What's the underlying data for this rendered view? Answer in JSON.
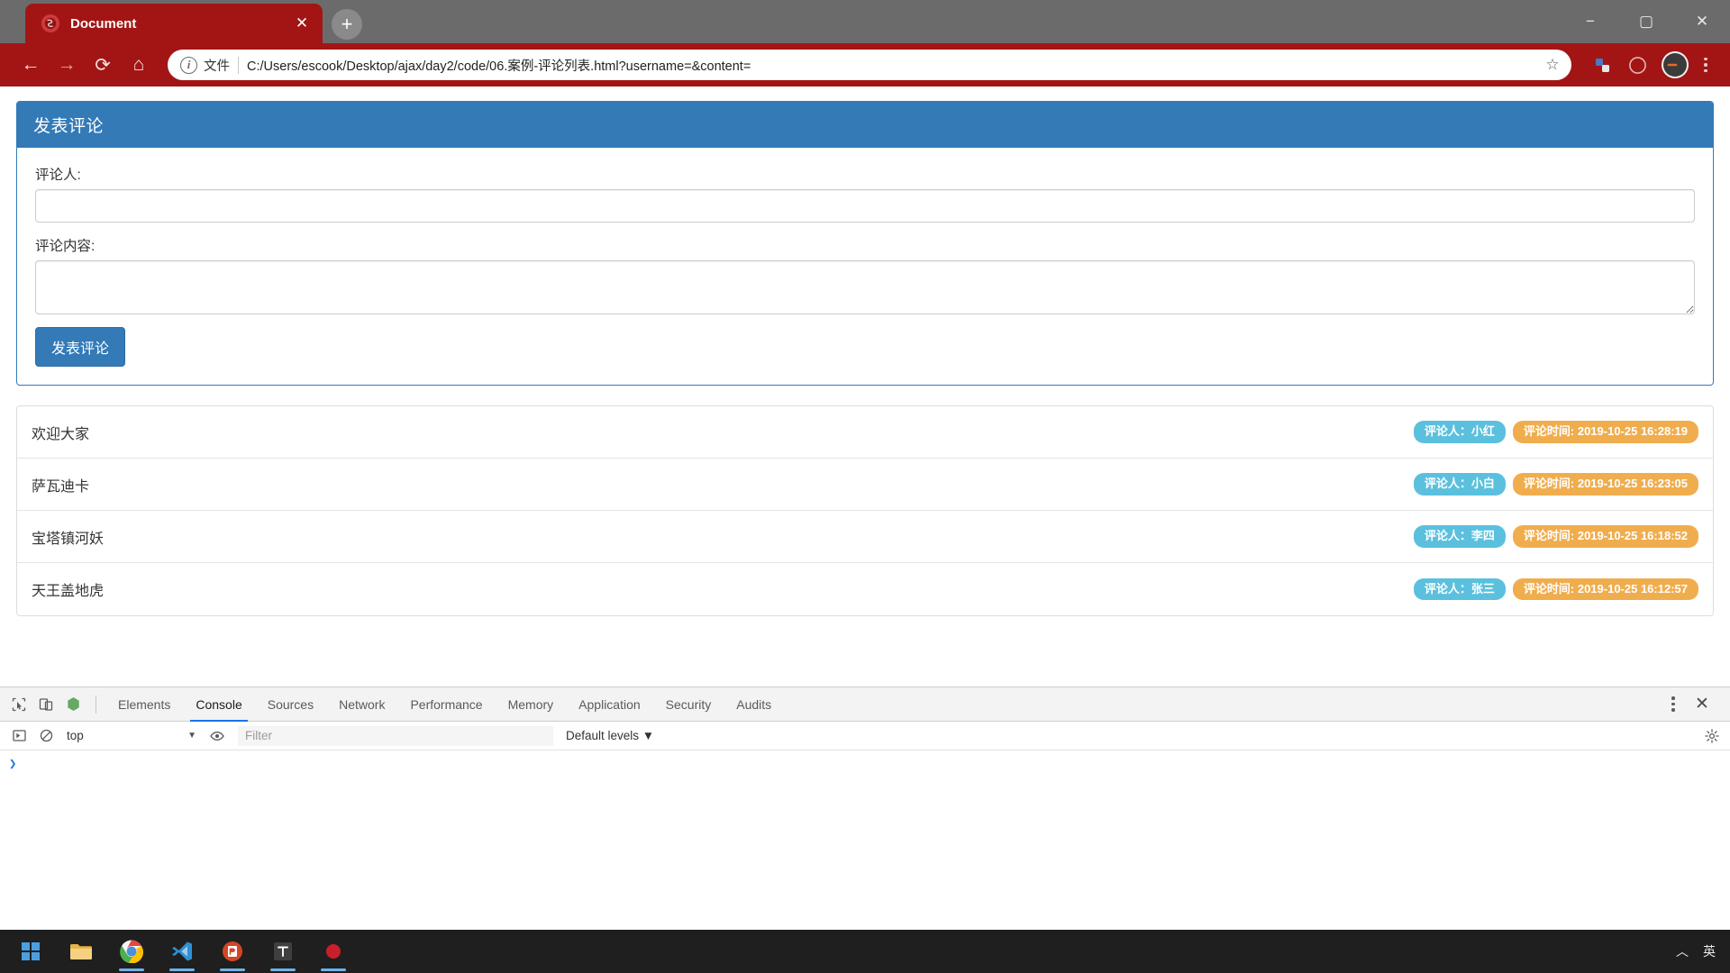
{
  "browser": {
    "tab": {
      "title": "Document",
      "favicon_name": "site-favicon",
      "close_label": "✕"
    },
    "new_tab_label": "+",
    "window_controls": {
      "minimize": "−",
      "maximize": "▢",
      "close": "✕"
    },
    "nav": {
      "back": "←",
      "forward": "→",
      "reload": "⟳",
      "home": "⌂"
    },
    "omnibox": {
      "scheme_label": "文件",
      "info_glyph": "i",
      "url": "C:/Users/escook/Desktop/ajax/day2/code/06.案例-评论列表.html?username=&content=",
      "star": "☆"
    },
    "toolbar_icons": [
      "extension-icon",
      "profile-circle-icon",
      "account-avatar-icon",
      "chrome-menu-icon"
    ]
  },
  "page": {
    "panel": {
      "title": "发表评论",
      "fields": [
        {
          "label": "评论人:",
          "value": "",
          "placeholder": "",
          "type": "input",
          "name": "username"
        },
        {
          "label": "评论内容:",
          "value": "",
          "placeholder": "",
          "type": "textarea",
          "name": "content"
        }
      ],
      "submit_label": "发表评论"
    },
    "comments": [
      {
        "text": "欢迎大家",
        "author_badge": "评论人：小红",
        "time_badge": "评论时间: 2019-10-25 16:28:19"
      },
      {
        "text": "萨瓦迪卡",
        "author_badge": "评论人：小白",
        "time_badge": "评论时间: 2019-10-25 16:23:05"
      },
      {
        "text": "宝塔镇河妖",
        "author_badge": "评论人：李四",
        "time_badge": "评论时间: 2019-10-25 16:18:52"
      },
      {
        "text": "天王盖地虎",
        "author_badge": "评论人：张三",
        "time_badge": "评论时间: 2019-10-25 16:12:57"
      }
    ],
    "colors": {
      "panel_accent": "#337ab7",
      "badge_info": "#5bc0de",
      "badge_warning": "#f0ad4e"
    }
  },
  "devtools": {
    "tools": [
      "inspect-element-icon",
      "device-toolbar-icon",
      "node-logo-icon"
    ],
    "tabs": [
      {
        "label": "Elements",
        "active": false
      },
      {
        "label": "Console",
        "active": true
      },
      {
        "label": "Sources",
        "active": false
      },
      {
        "label": "Network",
        "active": false
      },
      {
        "label": "Performance",
        "active": false
      },
      {
        "label": "Memory",
        "active": false
      },
      {
        "label": "Application",
        "active": false
      },
      {
        "label": "Security",
        "active": false
      },
      {
        "label": "Audits",
        "active": false
      }
    ],
    "close_label": "✕",
    "console": {
      "execute_icon": "execution-context-icon",
      "clear_icon": "clear-console-icon",
      "context": "top",
      "context_caret": "▼",
      "eye_icon": "live-expression-icon",
      "filter_placeholder": "Filter",
      "filter_value": "",
      "levels_label": "Default levels ▼",
      "settings_icon": "settings-gear-icon",
      "prompt": "❯"
    }
  },
  "taskbar": {
    "items": [
      {
        "name": "start-button",
        "running": false
      },
      {
        "name": "file-explorer-icon",
        "running": false
      },
      {
        "name": "chrome-icon",
        "running": true
      },
      {
        "name": "vscode-icon",
        "running": true
      },
      {
        "name": "powerpoint-icon",
        "running": true
      },
      {
        "name": "typora-icon",
        "running": true
      },
      {
        "name": "recording-app-icon",
        "running": true
      }
    ],
    "tray": {
      "chevron": "︿",
      "ime": "英"
    }
  }
}
